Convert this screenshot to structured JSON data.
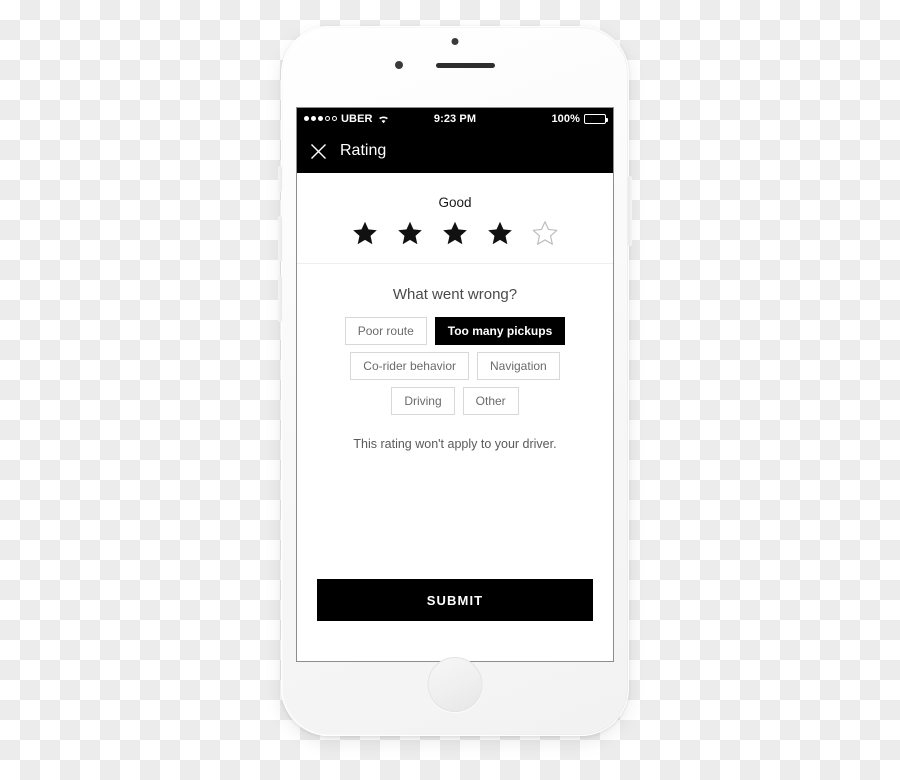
{
  "device": {
    "name": "iphone-white",
    "icons": {
      "camera": "camera-dot",
      "sensor": "proximity-sensor-dot",
      "speaker": "earpiece-speaker",
      "home": "home-button"
    }
  },
  "status_bar": {
    "signal_dots": [
      true,
      true,
      true,
      false,
      false
    ],
    "carrier": "UBER",
    "wifi_icon": "wifi-icon",
    "time": "9:23 PM",
    "battery_percent": "100%",
    "battery_level": 100
  },
  "nav_bar": {
    "close_icon": "close-icon",
    "title": "Rating"
  },
  "rating": {
    "label": "Good",
    "value": 4,
    "max": 5,
    "star_filled_icon": "star-filled-icon",
    "star_empty_icon": "star-outline-icon"
  },
  "feedback": {
    "question": "What went wrong?",
    "rows": [
      [
        {
          "label": "Poor route",
          "selected": false
        },
        {
          "label": "Too many pickups",
          "selected": true
        }
      ],
      [
        {
          "label": "Co-rider behavior",
          "selected": false
        },
        {
          "label": "Navigation",
          "selected": false
        }
      ],
      [
        {
          "label": "Driving",
          "selected": false
        },
        {
          "label": "Other",
          "selected": false
        }
      ]
    ],
    "disclaimer": "This rating won't apply to your driver."
  },
  "submit": {
    "label": "SUBMIT"
  },
  "colors": {
    "accent": "#000000",
    "chip_border": "#d8d8d8",
    "chip_text": "#6b6b6b",
    "screen_bg": "#ffffff"
  }
}
